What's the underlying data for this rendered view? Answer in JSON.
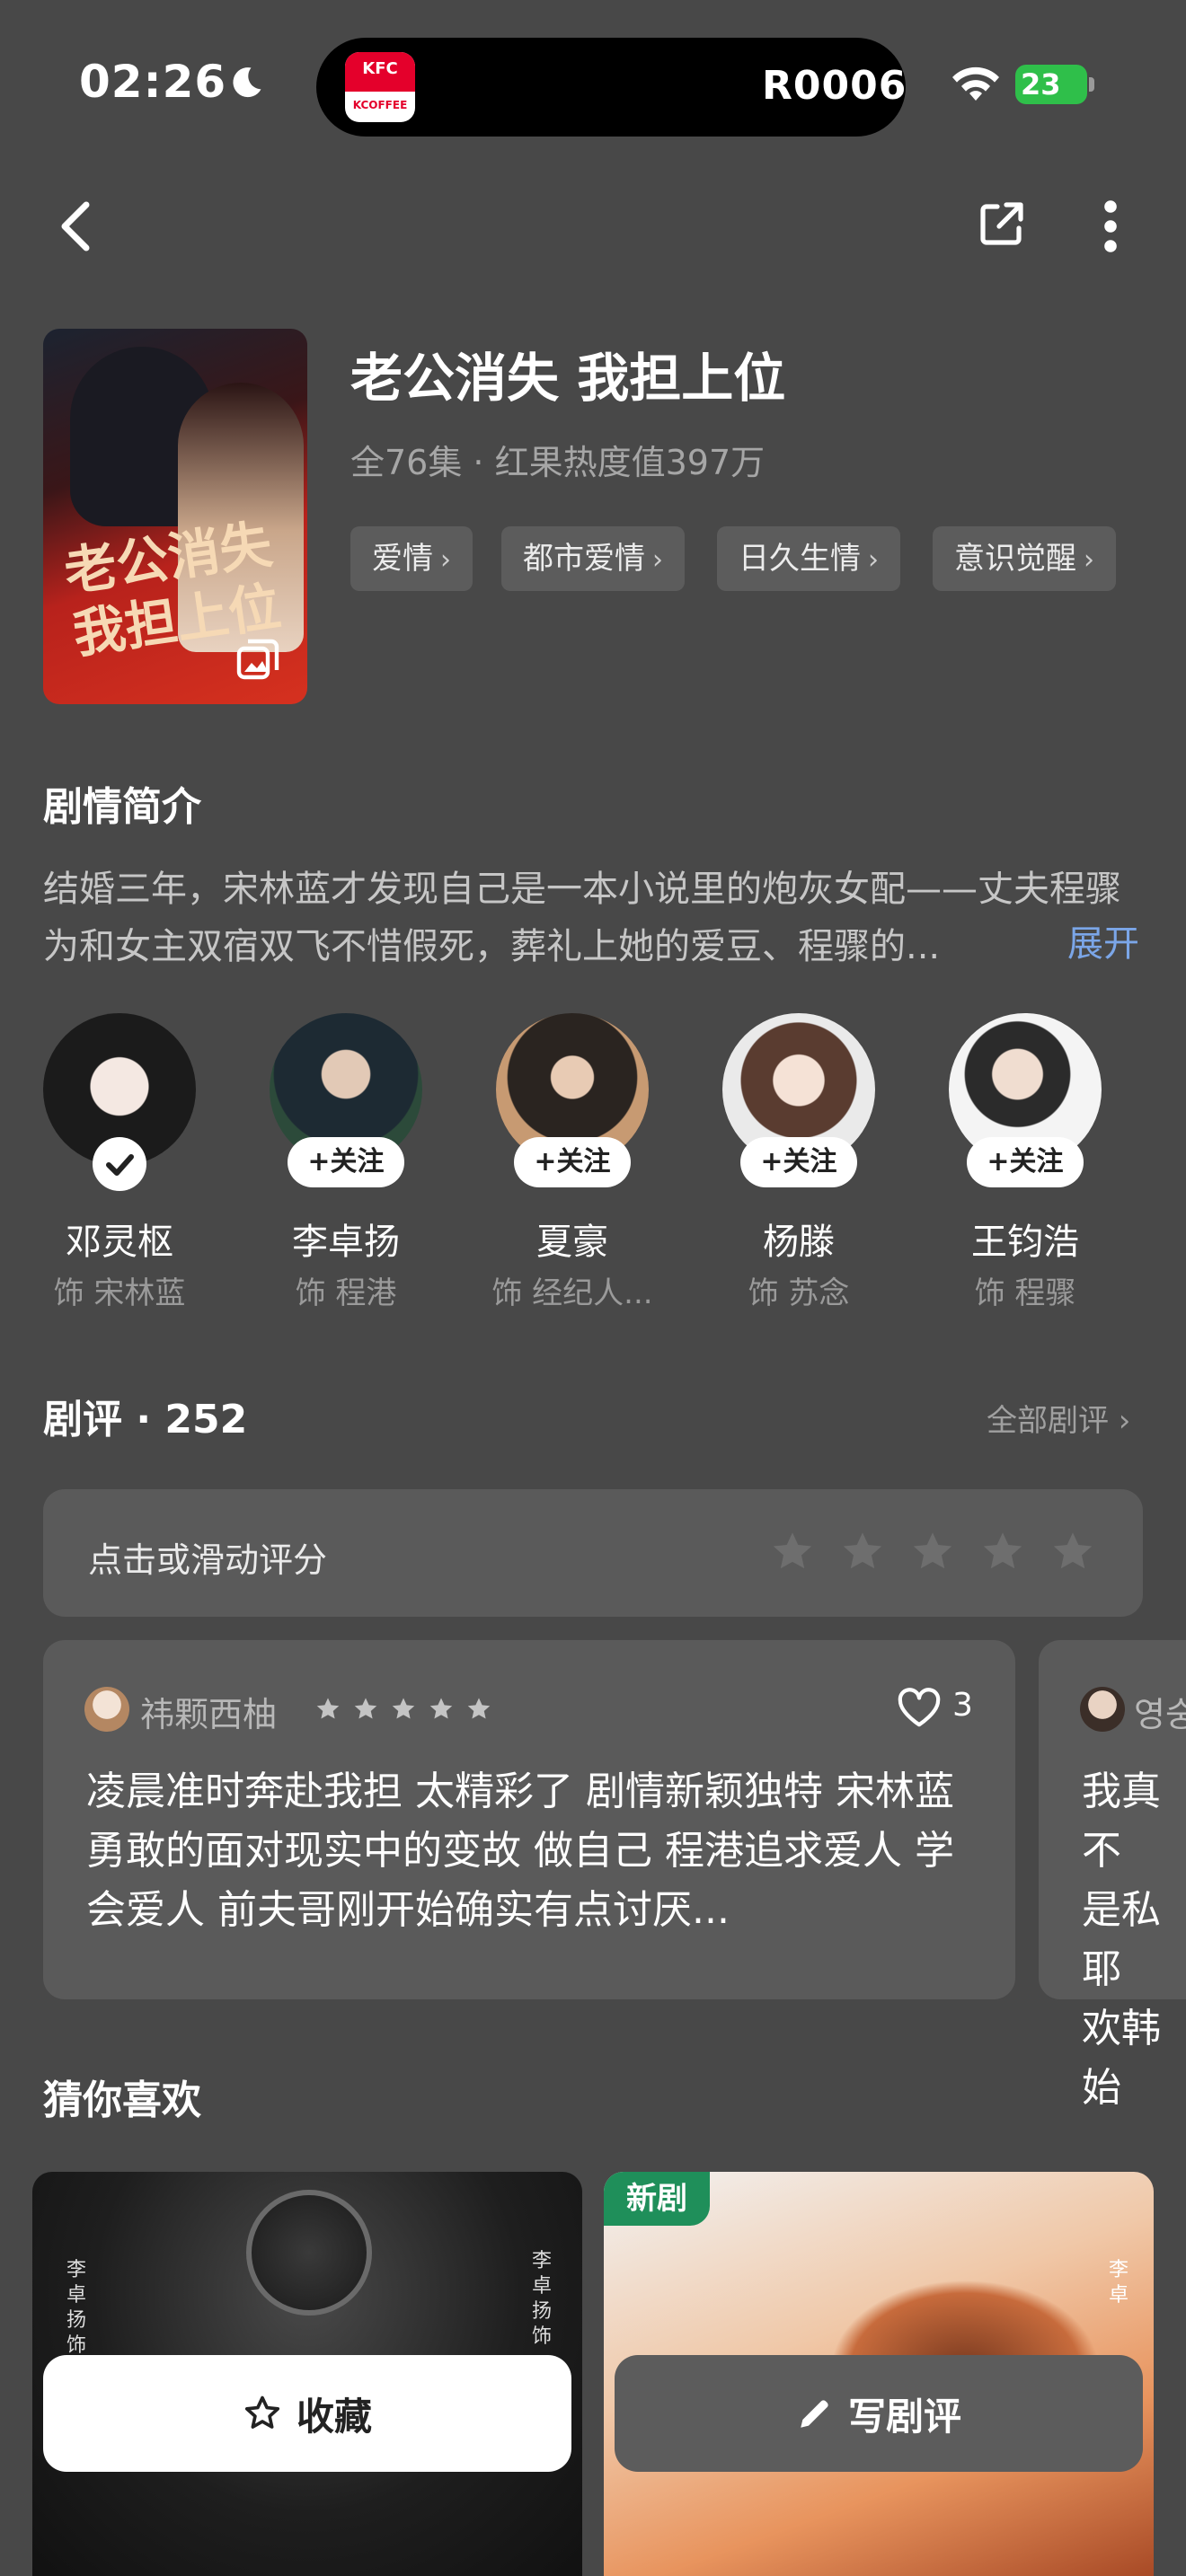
{
  "status_bar": {
    "time": "02:26",
    "island_code": "R0006",
    "battery": "23",
    "app_logo_top": "KFC",
    "app_logo_bottom": "KCOFFEE"
  },
  "show": {
    "title": "老公消失 我担上位",
    "meta": "全76集 · 红果热度值397万",
    "poster_title": "老公消失\n我担上位",
    "tags": [
      "爱情",
      "都市爱情",
      "日久生情",
      "意识觉醒"
    ]
  },
  "synopsis": {
    "title": "剧情简介",
    "text": "结婚三年，宋林蓝才发现自己是一本小说里的炮灰女配——丈夫程骤为和女主双宿双飞不惜假死，葬礼上她的爱豆、程骤的...",
    "expand_label": "展开"
  },
  "cast": [
    {
      "name": "邓灵枢",
      "role": "饰 宋林蓝",
      "followed": true,
      "follow_label": ""
    },
    {
      "name": "李卓扬",
      "role": "饰 程港",
      "followed": false,
      "follow_label": "+关注"
    },
    {
      "name": "夏豪",
      "role": "饰 经纪人...",
      "followed": false,
      "follow_label": "+关注"
    },
    {
      "name": "杨滕",
      "role": "饰 苏念",
      "followed": false,
      "follow_label": "+关注"
    },
    {
      "name": "王钧浩",
      "role": "饰 程骤",
      "followed": false,
      "follow_label": "+关注"
    }
  ],
  "reviews": {
    "title": "剧评 · 252",
    "all_label": "全部剧评 ›",
    "rate_prompt": "点击或滑动评分",
    "items": [
      {
        "user": "祎颗西柚",
        "stars": 5,
        "likes": "3",
        "text": "凌晨准时奔赴我担 太精彩了 剧情新颖独特 宋林蓝勇敢的面对现实中的变故 做自己 程港追求爱人 学会爱人 前夫哥刚开始确实有点讨厌..."
      },
      {
        "user": "영숭",
        "text": "我真不\n是私耶\n欢韩始"
      }
    ]
  },
  "recommend": {
    "title": "猜你喜欢",
    "new_badge": "新剧",
    "card1_cast": "李卓扬 饰",
    "card2_cast": "李卓"
  },
  "actions": {
    "favorite_label": "收藏",
    "write_review_label": "写剧评"
  },
  "colors": {
    "background": "#484848",
    "card": "#5a5a5a",
    "accent_link": "#7ba6e8",
    "new_badge": "#1f8f5a"
  }
}
